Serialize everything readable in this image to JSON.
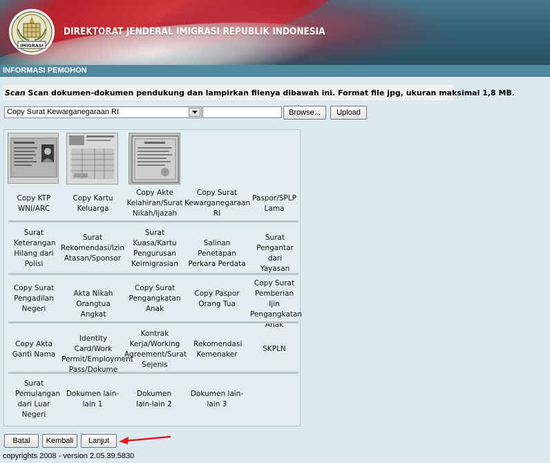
{
  "header": {
    "title": "DIREKTORAT JENDERAL IMIGRASI REPUBLIK INDONESIA",
    "logo_text": "IMIGRASI"
  },
  "section": {
    "title": "INFORMASI PEMOHON"
  },
  "instruction": {
    "emphasis": "Scan",
    "text": " Scan dokumen-dokumen pendukung dan lampirkan filenya dibawah ini. Format file jpg, ukuran maksimal 1,8 MB."
  },
  "upload": {
    "selected_document": "Copy Surat Kewarganegaraan RI",
    "file_value": "",
    "browse_label": "Browse...",
    "upload_label": "Upload"
  },
  "documents": [
    [
      "Copy KTP WNI/ARC",
      "Copy Kartu Keluarga",
      "Copy Akte Kelahiran/Surat Nikah/Ijazah",
      "Copy Surat Kewarganegaraan RI",
      "Paspor/SPLP Lama"
    ],
    [
      "Surat Keterangan Hilang dari Polisi",
      "Surat Rekomendasi/Izin Atasan/Sponsor",
      "Surat Kuasa/Kartu Pengurusan Keimigrasian",
      "Salinan Penetapan Perkara Perdata",
      "Surat Pengantar dari Yayasan"
    ],
    [
      "Copy Surat Pengadilan Negeri",
      "Akta Nikah Orangtua Angkat",
      "Copy Surat Pengangkatan Anak",
      "Copy Paspor Orang Tua",
      "Copy Surat Pemberian Ijin Pengangkatan Anak"
    ],
    [
      "Copy Akta Ganti Nama",
      "Identity Card/Work Permit/Employment Pass/Dokume",
      "Kontrak Kerja/Working Agreement/Surat Sejenis",
      "Rekomendasi Kemenaker",
      "SKPLN"
    ],
    [
      "Surat Pemulangan dari Luar Negeri",
      "Dokumen lain-lain 1",
      "Dokumen lain-lain 2",
      "Dokumen lain-lain 3",
      ""
    ]
  ],
  "thumbnails": [
    "ktp-thumbnail",
    "kartu-keluarga-thumbnail",
    "akte-thumbnail"
  ],
  "nav": {
    "cancel_label": "Batal",
    "back_label": "Kembali",
    "next_label": "Lanjut"
  },
  "annotation_color": "#e8141c",
  "footer": {
    "copyright": "copyrights 2008 - version 2.05.39.5830"
  }
}
